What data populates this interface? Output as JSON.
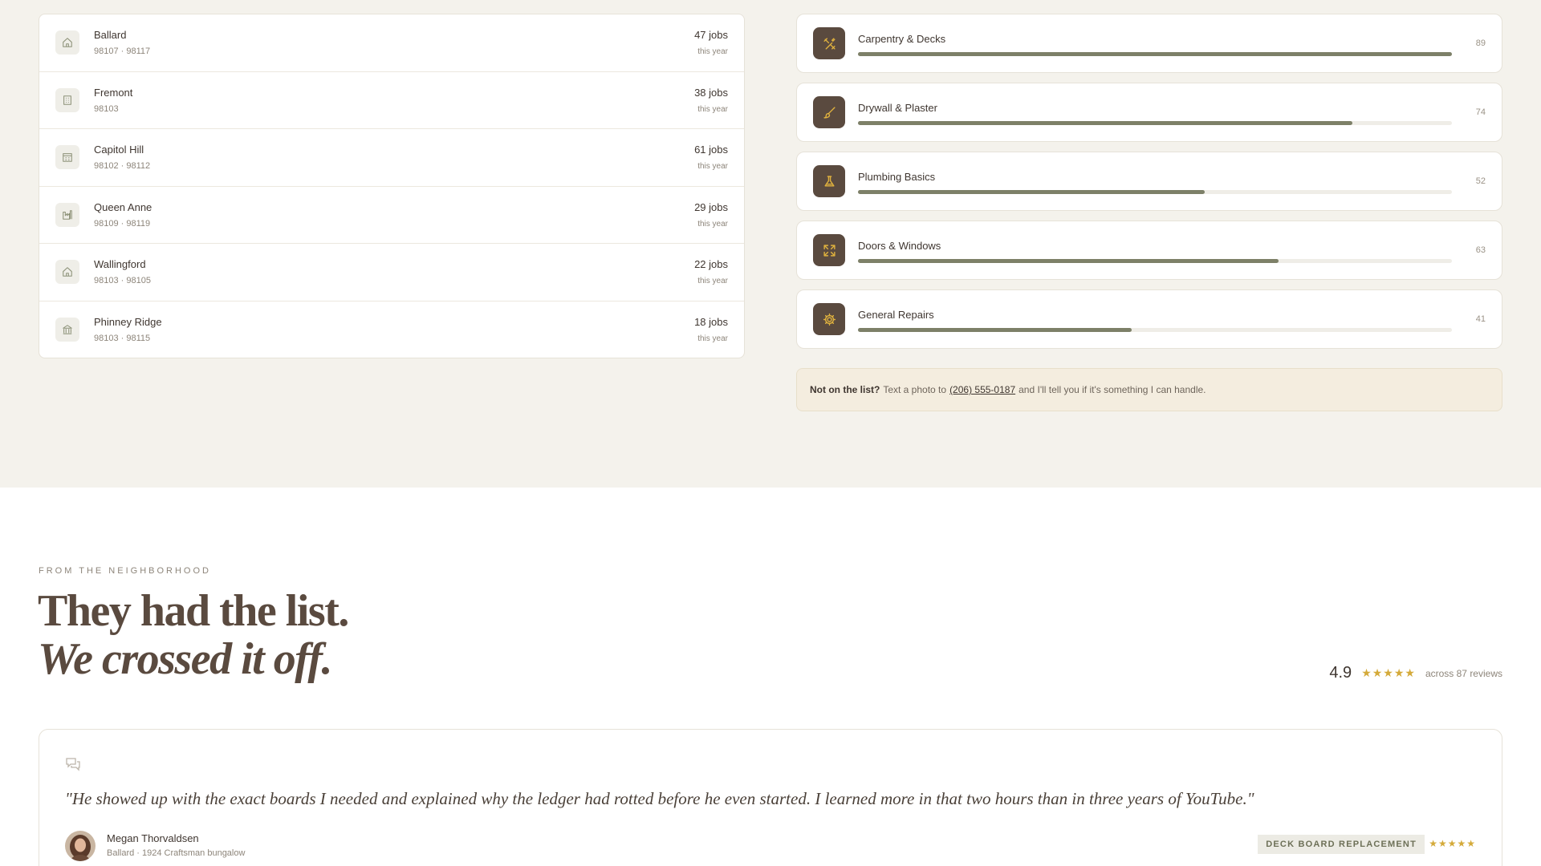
{
  "neighborhoods": [
    {
      "name": "Ballard",
      "zips": "98107 · 98117",
      "jobs": "47 jobs",
      "period": "this year",
      "icon": "house-icon"
    },
    {
      "name": "Fremont",
      "zips": "98103",
      "jobs": "38 jobs",
      "period": "this year",
      "icon": "building-icon"
    },
    {
      "name": "Capitol Hill",
      "zips": "98102 · 98112",
      "jobs": "61 jobs",
      "period": "this year",
      "icon": "apartment-icon"
    },
    {
      "name": "Queen Anne",
      "zips": "98109 · 98119",
      "jobs": "29 jobs",
      "period": "this year",
      "icon": "factory-icon"
    },
    {
      "name": "Wallingford",
      "zips": "98103 · 98105",
      "jobs": "22 jobs",
      "period": "this year",
      "icon": "house-icon"
    },
    {
      "name": "Phinney Ridge",
      "zips": "98103 · 98115",
      "jobs": "18 jobs",
      "period": "this year",
      "icon": "landmark-icon"
    }
  ],
  "services": [
    {
      "name": "Carpentry & Decks",
      "count": "89",
      "fill": 1.0,
      "icon": "tools-icon"
    },
    {
      "name": "Drywall & Plaster",
      "count": "74",
      "fill": 0.832,
      "icon": "brush-icon"
    },
    {
      "name": "Plumbing Basics",
      "count": "52",
      "fill": 0.584,
      "icon": "flask-icon"
    },
    {
      "name": "Doors & Windows",
      "count": "63",
      "fill": 0.708,
      "icon": "expand-icon"
    },
    {
      "name": "General Repairs",
      "count": "41",
      "fill": 0.461,
      "icon": "gear-icon"
    }
  ],
  "note": {
    "lead": "Not on the list?",
    "before": "Text a photo to",
    "phone": "(206) 555-0187",
    "after": "and I'll tell you if it's something I can handle."
  },
  "reviews_section": {
    "eyebrow": "FROM THE NEIGHBORHOOD",
    "headline_line1": "They had the list.",
    "headline_line2": "We crossed it off.",
    "rating": "4.9",
    "rating_stars": "★★★★★",
    "rating_sub": "across 87 reviews"
  },
  "review": {
    "quote": "\"He showed up with the exact boards I needed and explained why the ledger had rotted before he even started. I learned more in that two hours than in three years of YouTube.\"",
    "author": "Megan Thorvaldsen",
    "author_sub": "Ballard · 1924 Craftsman bungalow",
    "tag": "DECK BOARD REPLACEMENT",
    "stars": "★★★★★"
  },
  "colors": {
    "accent_dark": "#5a4a3f",
    "bar_fill": "#7d8068",
    "star_gold": "#d4aa3a",
    "icon_gold": "#e0b23e"
  }
}
